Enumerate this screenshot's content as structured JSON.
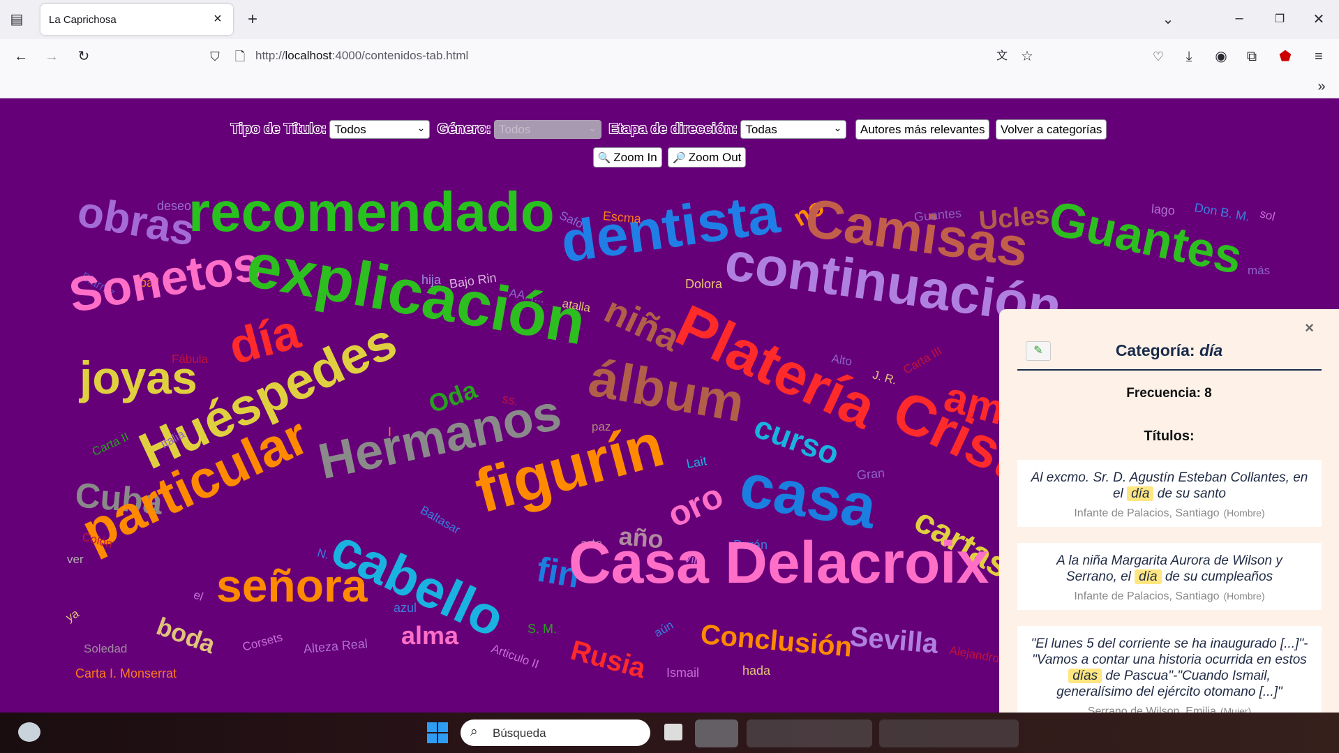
{
  "browser": {
    "tab_title": "La Caprichosa",
    "tab_close": "×",
    "new_tab": "+",
    "url_prefix": "http://",
    "url_host": "localhost",
    "url_rest": ":4000/contenidos-tab.html",
    "icons": [
      "tab-list-icon",
      "back-icon",
      "forward-icon",
      "reload-icon",
      "shield-icon",
      "page-icon",
      "translate-icon",
      "star-icon",
      "pocket-icon",
      "download-icon",
      "account-icon",
      "extensions-icon",
      "ublock-icon",
      "menu-icon",
      "overflow-icon",
      "minimize-icon",
      "restore-icon",
      "close-icon",
      "tab-overflow-chevron-icon"
    ]
  },
  "controls": {
    "tipo_label": "Tipo de Título:",
    "tipo_value": "Todos",
    "genero_label": "Género:",
    "genero_value": "Todos",
    "etapa_label": "Etapa de dirección:",
    "etapa_value": "Todas",
    "autores_button": "Autores más relevantes",
    "volver_button": "Volver a categorías",
    "zoom_in": "Zoom In",
    "zoom_out": "Zoom Out"
  },
  "colors": {
    "page_background": "#660078",
    "panel_background": "#fdf1e8",
    "highlight": "#ffe680"
  },
  "word_cloud": [
    {
      "text": "deseo",
      "color": "#9b6fcf",
      "size": 18,
      "rotate": 0
    },
    {
      "text": "obras",
      "color": "#a46bd6",
      "size": 62,
      "rotate": 10
    },
    {
      "text": "recomendado",
      "color": "#28c21f",
      "size": 80,
      "rotate": 0
    },
    {
      "text": "dentista",
      "color": "#1f7fe6",
      "size": 82,
      "rotate": -8
    },
    {
      "text": "Safo",
      "color": "#8a6ad0",
      "size": 17,
      "rotate": 25
    },
    {
      "text": "Escma",
      "color": "#ff7a1a",
      "size": 18,
      "rotate": 5
    },
    {
      "text": "no",
      "color": "#ff8a00",
      "size": 36,
      "rotate": -30
    },
    {
      "text": "Camisas",
      "color": "#c25f4a",
      "size": 78,
      "rotate": 8
    },
    {
      "text": "Guantes",
      "color": "#8a5fb5",
      "size": 18,
      "rotate": -5
    },
    {
      "text": "Ucles",
      "color": "#b25f4a",
      "size": 38,
      "rotate": -5
    },
    {
      "text": "Guantes",
      "color": "#2dbe1f",
      "size": 70,
      "rotate": 12
    },
    {
      "text": "lago",
      "color": "#b06fd0",
      "size": 18,
      "rotate": 5
    },
    {
      "text": "Don B. M.",
      "color": "#3a7fe0",
      "size": 18,
      "rotate": 10
    },
    {
      "text": "sol",
      "color": "#c66fd9",
      "size": 17,
      "rotate": 15
    },
    {
      "text": "más",
      "color": "#8f63c7",
      "size": 17,
      "rotate": 0
    },
    {
      "text": "Biarritz",
      "color": "#5a4fc0",
      "size": 17,
      "rotate": 30
    },
    {
      "text": "bail",
      "color": "#ff7a1a",
      "size": 18,
      "rotate": 0
    },
    {
      "text": "hija",
      "color": "#9b8fe0",
      "size": 18,
      "rotate": 0
    },
    {
      "text": "Bajo Rin",
      "color": "#d9b3e0",
      "size": 18,
      "rotate": -8
    },
    {
      "text": "AA. [...",
      "color": "#8f63c7",
      "size": 17,
      "rotate": 10
    },
    {
      "text": "Dolora",
      "color": "#e8c27a",
      "size": 18,
      "rotate": 0
    },
    {
      "text": "continuación",
      "color": "#b080e0",
      "size": 78,
      "rotate": 8
    },
    {
      "text": "Sonetos",
      "color": "#ff6fc8",
      "size": 70,
      "rotate": -10
    },
    {
      "text": "explicación",
      "color": "#2dbe1f",
      "size": 90,
      "rotate": 10
    },
    {
      "text": "atalla",
      "color": "#e0c27a",
      "size": 17,
      "rotate": 10
    },
    {
      "text": "niña",
      "color": "#b25f4a",
      "size": 54,
      "rotate": 25
    },
    {
      "text": "Platería",
      "color": "#ff2a2a",
      "size": 84,
      "rotate": 25
    },
    {
      "text": "Fábula",
      "color": "#c0123a",
      "size": 17,
      "rotate": 0
    },
    {
      "text": "día",
      "color": "#ff2a2a",
      "size": 70,
      "rotate": -15
    },
    {
      "text": "Alto",
      "color": "#8f63c7",
      "size": 17,
      "rotate": 10
    },
    {
      "text": "J. R.",
      "color": "#e0c27a",
      "size": 17,
      "rotate": 15
    },
    {
      "text": "Carta III",
      "color": "#c0123a",
      "size": 17,
      "rotate": -30
    },
    {
      "text": "joyas",
      "color": "#e0d040",
      "size": 66,
      "rotate": 0
    },
    {
      "text": "Oda",
      "color": "#28a020",
      "size": 36,
      "rotate": -20
    },
    {
      "text": "ss.",
      "color": "#c0123a",
      "size": 18,
      "rotate": 10
    },
    {
      "text": "álbum",
      "color": "#b25f4a",
      "size": 76,
      "rotate": 10
    },
    {
      "text": "Cristal",
      "color": "#ff2a2a",
      "size": 82,
      "rotate": 25
    },
    {
      "text": "Huéspedes",
      "color": "#e0d040",
      "size": 74,
      "rotate": -25
    },
    {
      "text": "Hermanos",
      "color": "#8a8a8a",
      "size": 72,
      "rotate": -12
    },
    {
      "text": "paz",
      "color": "#b08a7a",
      "size": 17,
      "rotate": 0
    },
    {
      "text": "curso",
      "color": "#1ab2e0",
      "size": 46,
      "rotate": 20
    },
    {
      "text": "Carta II",
      "color": "#28a020",
      "size": 17,
      "rotate": -25
    },
    {
      "text": "Italia",
      "color": "#8f63c7",
      "size": 17,
      "rotate": -30
    },
    {
      "text": "I",
      "color": "#ff7a1a",
      "size": 18,
      "rotate": 0
    },
    {
      "text": "Lait",
      "color": "#1ab2e0",
      "size": 18,
      "rotate": -10
    },
    {
      "text": "Gran",
      "color": "#8f63c7",
      "size": 18,
      "rotate": -5
    },
    {
      "text": "Cuba",
      "color": "#8a8a8a",
      "size": 50,
      "rotate": 5
    },
    {
      "text": "figurín",
      "color": "#ff8a00",
      "size": 88,
      "rotate": -15
    },
    {
      "text": "casa",
      "color": "#1a7fe0",
      "size": 88,
      "rotate": 10
    },
    {
      "text": "Baltasar",
      "color": "#3a7fe0",
      "size": 17,
      "rotate": 30
    },
    {
      "text": "particular",
      "color": "#ff8a00",
      "size": 76,
      "rotate": -25
    },
    {
      "text": "oro",
      "color": "#ff6fc8",
      "size": 50,
      "rotate": -25
    },
    {
      "text": "Colón",
      "color": "#c0123a",
      "size": 17,
      "rotate": 15
    },
    {
      "text": "ver",
      "color": "#b0b0b0",
      "size": 17,
      "rotate": 0
    },
    {
      "text": "arte",
      "color": "#a08aa0",
      "size": 18,
      "rotate": 0
    },
    {
      "text": "año",
      "color": "#b08aa0",
      "size": 36,
      "rotate": 5
    },
    {
      "text": "Villa",
      "color": "#c66fd9",
      "size": 17,
      "rotate": 10
    },
    {
      "text": "Durán",
      "color": "#3a7fe0",
      "size": 18,
      "rotate": 0
    },
    {
      "text": "cartas",
      "color": "#e0d040",
      "size": 50,
      "rotate": 30
    },
    {
      "text": "N.",
      "color": "#3a7fe0",
      "size": 17,
      "rotate": 15
    },
    {
      "text": "cabello",
      "color": "#1ab2e0",
      "size": 76,
      "rotate": 25
    },
    {
      "text": "fin",
      "color": "#1a7fe0",
      "size": 50,
      "rotate": 10
    },
    {
      "text": "Casa Delacroix",
      "color": "#ff6fc8",
      "size": 84,
      "rotate": 0
    },
    {
      "text": "ya",
      "color": "#e0c27a",
      "size": 17,
      "rotate": -30
    },
    {
      "text": "el",
      "color": "#c66fd9",
      "size": 17,
      "rotate": 20
    },
    {
      "text": "señora",
      "color": "#ff8a00",
      "size": 66,
      "rotate": 0
    },
    {
      "text": "azul",
      "color": "#3a7fe0",
      "size": 18,
      "rotate": 0
    },
    {
      "text": "S. M.",
      "color": "#28a020",
      "size": 18,
      "rotate": 0
    },
    {
      "text": "boda",
      "color": "#e0c27a",
      "size": 36,
      "rotate": 20
    },
    {
      "text": "Soledad",
      "color": "#a08aa0",
      "size": 17,
      "rotate": 0
    },
    {
      "text": "Corsets",
      "color": "#c66fd9",
      "size": 17,
      "rotate": -15
    },
    {
      "text": "Alteza Real",
      "color": "#b06fd0",
      "size": 18,
      "rotate": -5
    },
    {
      "text": "alma",
      "color": "#ff6fc8",
      "size": 36,
      "rotate": 0
    },
    {
      "text": "Articulo II",
      "color": "#c66fd9",
      "size": 17,
      "rotate": 20
    },
    {
      "text": "Rusia",
      "color": "#ff2a2a",
      "size": 40,
      "rotate": 15
    },
    {
      "text": "aún",
      "color": "#3a7fe0",
      "size": 17,
      "rotate": -30
    },
    {
      "text": "Conclusión",
      "color": "#ff8a00",
      "size": 40,
      "rotate": 5
    },
    {
      "text": "Sevilla",
      "color": "#b080e0",
      "size": 40,
      "rotate": 5
    },
    {
      "text": "Alejandro",
      "color": "#c0123a",
      "size": 17,
      "rotate": 10
    },
    {
      "text": "Carta I. Monserrat",
      "color": "#ff7a1a",
      "size": 18,
      "rotate": 0
    },
    {
      "text": "Ismail",
      "color": "#c66fd9",
      "size": 18,
      "rotate": 0
    },
    {
      "text": "hada",
      "color": "#e0c27a",
      "size": 18,
      "rotate": 0
    },
    {
      "text": "am",
      "color": "#ff2a2a",
      "size": 60,
      "rotate": 15
    }
  ],
  "panel": {
    "close": "×",
    "title_prefix": "Categoría: ",
    "title_word": "día",
    "frequency_label": "Frecuencia: 8",
    "titles_heading": "Títulos:",
    "entries": [
      {
        "before": "Al excmo. Sr. D. Agustín Esteban Collantes, en el",
        "match": "día",
        "after": "de su santo",
        "author": "Infante de Palacios, Santiago",
        "gender": "(Hombre)"
      },
      {
        "before": "A la niña Margarita Aurora de Wilson y Serrano, el",
        "match": "día",
        "after": "de su cumpleaños",
        "author": "Infante de Palacios, Santiago",
        "gender": "(Hombre)"
      },
      {
        "before": "\"El lunes 5 del corriente se ha inaugurado [...]\"-\"Vamos a contar una historia ocurrida en estos",
        "match": "días",
        "after": "de Pascua\"-\"Cuando Ismail, generalísimo del ejército otomano [...]\"",
        "author": "Serrano de Wilson, Emilia",
        "gender": "(Mujer)"
      }
    ]
  },
  "taskbar": {
    "search_placeholder": "Búsqueda",
    "icons": [
      "weather-icon",
      "start-icon",
      "search-icon",
      "task-view-icon"
    ]
  }
}
